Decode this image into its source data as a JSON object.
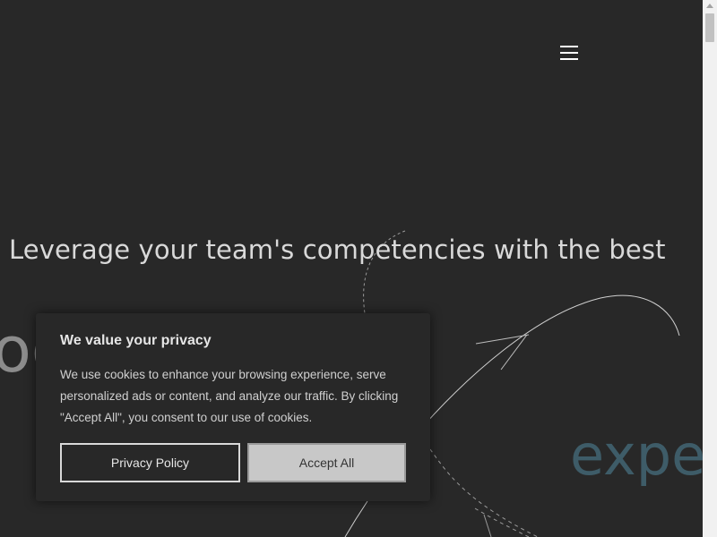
{
  "header": {
    "menu_icon": "hamburger-menu-icon"
  },
  "hero": {
    "headline": "Leverage your team's competencies with the best",
    "word_partial": "og",
    "word_expe": "expe"
  },
  "cookie_banner": {
    "title": "We value your privacy",
    "text": "We use cookies to enhance your browsing experience, serve personalized ads or content, and analyze our traffic. By clicking \"Accept All\", you consent to our use of cookies.",
    "privacy_button_label": "Privacy Policy",
    "accept_button_label": "Accept All"
  },
  "colors": {
    "background": "#282828",
    "headline": "#d9d9d9",
    "accent_word": "#3e5c68"
  }
}
